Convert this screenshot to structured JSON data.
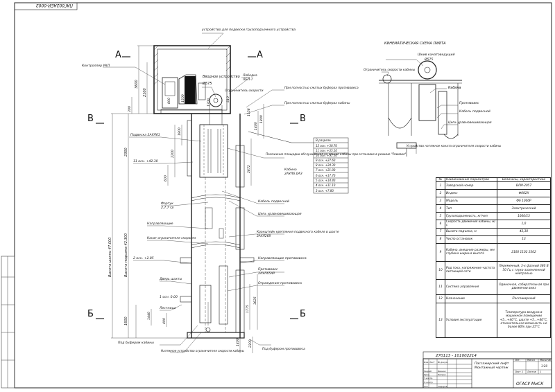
{
  "sheet": {
    "corner_stamp": "ПАГ002АЕЙ-0002",
    "doc_code": "270113 - 101002214",
    "doc_title": "Пассажирский лифт",
    "doc_subtitle": "Монтажный чертеж",
    "org": "ОГАСУ МиСК",
    "sheet_no": "1",
    "sheets": "1",
    "scale": "1:20",
    "stage_hdr": "Лит.",
    "mass_hdr": "Масса",
    "scale_hdr": "Масштаб",
    "sheet_hdr": "Лист",
    "sheets_hdr": "Листов",
    "signature_rows": [
      {
        "role": "Изм.",
        "name": "Лист",
        "sign": "№ докум."
      },
      {
        "role": "Разраб.",
        "name": "Иванов",
        "sign": ""
      },
      {
        "role": "Пров.",
        "name": "Петров",
        "sign": ""
      },
      {
        "role": "Т.контр.",
        "name": "",
        "sign": ""
      },
      {
        "role": "Н.контр.",
        "name": "",
        "sign": ""
      },
      {
        "role": "Утв.",
        "name": "Сидоров",
        "sign": ""
      }
    ]
  },
  "sections": {
    "a_left": "А",
    "a_right": "А",
    "b_left": "В",
    "b_right": "В",
    "c_left": "Б",
    "c_right": "Б"
  },
  "kinematic": {
    "title": "КИНЕМАТИЧЕСКАЯ СХЕМА ЛИФТА",
    "labels": {
      "pulley": "Шкив канатоведущий",
      "pulley_dia": "Ø575",
      "limiter": "Ограничитель скорости кабины",
      "cabin": "Кабина",
      "counterweight": "Противовес",
      "cable": "Кабель подвесной",
      "chain": "Цепь уравновешивающая",
      "tension": "Устройство натяжное каната ограничителя скорости кабины"
    }
  },
  "drawing_labels": {
    "machine_room_hook": "устройство для подвески грузоподъемного устройства",
    "controller": "Контроллер УКЛ",
    "winch": "Лебедка",
    "winch_type": "ЛБЛ-Т",
    "intro_device": "Вводное устройство",
    "pulley_dia": "Ø575",
    "limiter_top": "Ограничитель скорости",
    "stop_cw": "При полностью сжатых буферах противовеса",
    "stop_cab": "При полностью сжатых буферах кабины",
    "beam": "Подвеска 2АУЛ61",
    "service_area": "Положение площадки обслуживания на крыше кабины при остановке в режиме \"Ревизия\"",
    "cabin": "Кабина",
    "cabin_type": "2АУЛ6.0АЗ",
    "counterweight_frame": "Противовес",
    "shaft_door": "Дверь шахты",
    "hanging_cable": "Кабель подвесной",
    "chain": "Цепь уравновешивающая",
    "bracket": "Кронштейн крепления подвесного кабеля в шахте",
    "bracket_type": "2АУЛ268",
    "limiter_rope": "Канат ограничителя скорости",
    "guide_cab": "Направляющие",
    "guide_cw": "Направляющие противовеса",
    "cw": "Противовес",
    "cw_type": "2АУЛ65АР",
    "cw_guard": "Ограждение противовеса",
    "ladder": "Лестница",
    "tension_dev": "Натяжное устройство ограничителя скорости кабины",
    "cab_buffer": "Под буфером кабины",
    "cw_buffer": "Под буфером противовеса",
    "pit_mark": "1 осн. 0.00",
    "floor2": "2 осн. +2.85",
    "floor11": "11 осн. +42.30",
    "door_label": "Фартук",
    "door_type": "2,7,7 гр"
  },
  "dimensions": {
    "shaft_height": "Высота шахты 47.000",
    "lift_height": "Высота подъема 42.300",
    "top_gap": "3600",
    "room_h": "2100",
    "room_h2": "2300",
    "pit": "1600",
    "pit2": "1400",
    "cabin_h": "2200",
    "d1": "1900",
    "d2": "800",
    "d3": "1200",
    "d4": "1400",
    "d5": "2672",
    "d6": "1775",
    "d7": "3625",
    "d8": "1440",
    "d9": "2300",
    "d10": "1800",
    "d11": "400",
    "d12": "510",
    "d13": "1156",
    "d14": "1500",
    "d15": "600",
    "d16": "300"
  },
  "floors": {
    "header": "В разрезе",
    "rows": [
      "12 осн. +38.70",
      "11 осн. +35.10",
      "10 осн. +31.50",
      "9 осн. +27.60",
      "8 осн. +24.30",
      "7 осн. +21.00",
      "6 осн. +17.70",
      "5 осн. +14.40",
      "4 осн. +11.10",
      "3 осн. +7.80"
    ]
  },
  "spec_table": {
    "header": [
      "№",
      "Наименование параметров",
      "Величины, характеристики"
    ],
    "rows": [
      [
        "1",
        "Заводской номер",
        "ВЛМ-2057"
      ],
      [
        "2",
        "Индекс",
        "Ф082Х"
      ],
      [
        "3",
        "Модель",
        "Ф6 1000Р"
      ],
      [
        "4",
        "Тип",
        "Электрический"
      ],
      [
        "5",
        "Грузоподъемность, кг/чел",
        "1000/13"
      ],
      [
        "6",
        "Скорость движения кабины, м/с",
        "1,0"
      ],
      [
        "7",
        "Высота подъема, м",
        "42,30"
      ],
      [
        "8",
        "Число остановок",
        "13"
      ],
      [
        "9",
        "Кабина, внешние размеры, мм глубина ширина высота",
        "2100 1102 2302"
      ],
      [
        "10",
        "Род тока, напряжение частота питающей сети",
        "Переменный, 3-х фазный 380 В 50 Гц с глухо-заземленной нейтралью"
      ],
      [
        "11",
        "Система управления",
        "Одиночная, собирательная при движении вниз"
      ],
      [
        "12",
        "Назначение",
        "Пассажирский"
      ],
      [
        "13",
        "Условия эксплуатации",
        "Температура воздуха в машинном помещении +5...+40°С, шахте +5...+40°С, относительная влажность не более 80% при 25°С"
      ]
    ]
  }
}
